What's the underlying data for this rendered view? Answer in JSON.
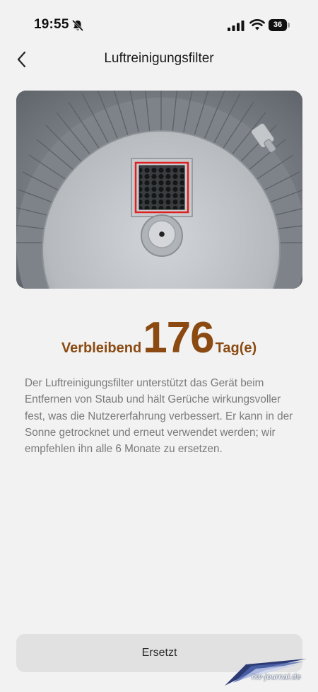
{
  "status_bar": {
    "time": "19:55",
    "battery": "36",
    "icons": [
      "bell-slash-icon",
      "cellular-signal-icon",
      "wifi-icon",
      "battery-icon"
    ]
  },
  "nav": {
    "title": "Luftreinigungsfilter",
    "back_icon": "chevron-left-icon"
  },
  "hero": {
    "image": "air-purifier-filter-photo",
    "highlight_color": "#e02020"
  },
  "remaining": {
    "prefix": "Verbleibend",
    "days": "176",
    "unit": "Tag(e)",
    "color": "#8a4a12"
  },
  "description": "Der Luftreinigungsfilter unterstützt das Gerät beim Entfernen von Staub und hält Gerüche wirkungsvoller fest, was die Nutzererfahrung verbessert. Er kann in der Sonne getrocknet und erneut verwendet werden; wir empfehlen ihn alle 6 Monate zu ersetzen.",
  "actions": {
    "replace_label": "Ersetzt"
  },
  "watermark": {
    "text": "hw-journal.de"
  }
}
